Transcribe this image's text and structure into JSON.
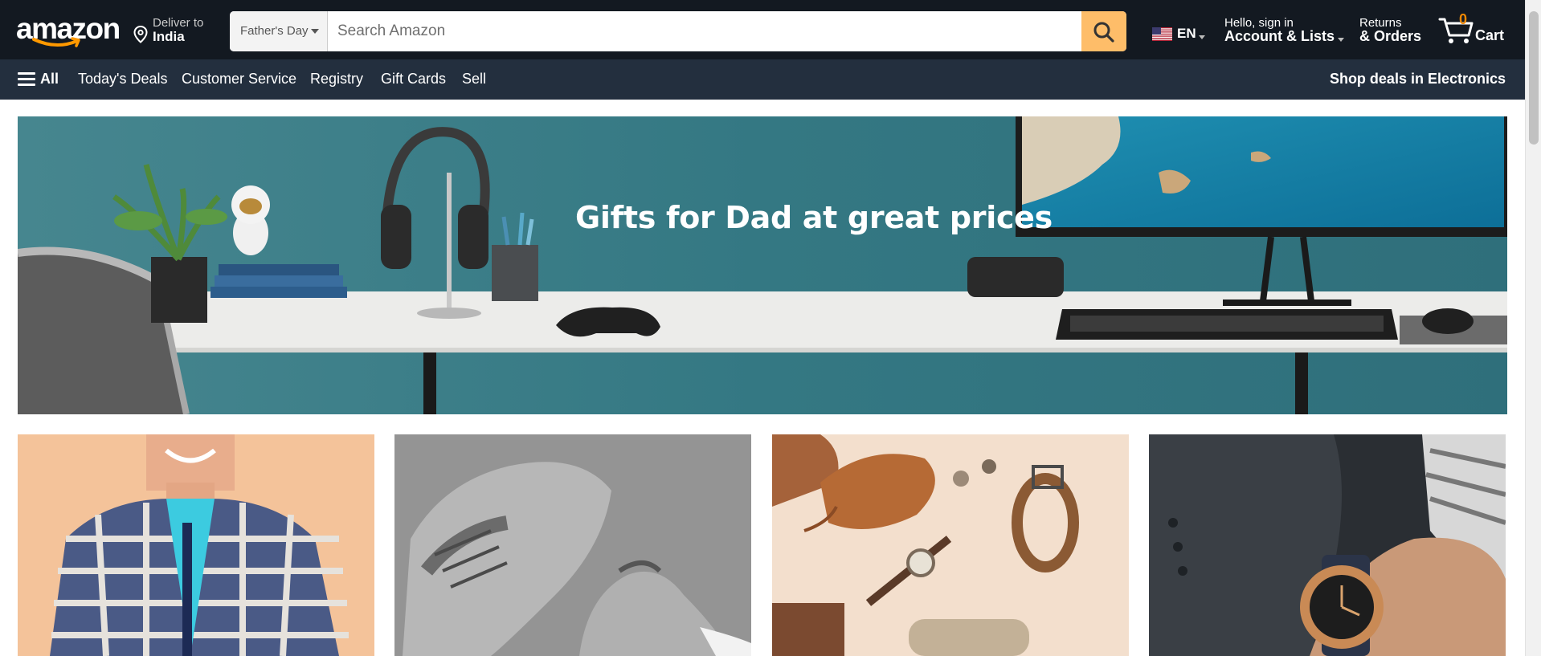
{
  "header": {
    "logo_alt": "amazon",
    "deliver": {
      "line1": "Deliver to",
      "line2": "India",
      "icon": "location-pin-icon"
    },
    "search": {
      "category": "Father's Day",
      "placeholder": "Search Amazon",
      "value": "",
      "button_icon": "search-icon"
    },
    "language": {
      "code": "EN",
      "flag_icon": "us-flag-icon"
    },
    "account": {
      "line1": "Hello, sign in",
      "line2": "Account & Lists"
    },
    "returns": {
      "line1": "Returns",
      "line2": "& Orders"
    },
    "cart": {
      "count": "0",
      "label": "Cart",
      "icon": "cart-icon"
    }
  },
  "subnav": {
    "all_label": "All",
    "items": [
      "Today's Deals",
      "Customer Service",
      "Registry",
      "Gift Cards",
      "Sell"
    ],
    "promo": "Shop deals in Electronics"
  },
  "hero": {
    "headline": "Gifts for Dad at great prices"
  },
  "tiles": [
    {
      "name": "shirt-tile"
    },
    {
      "name": "shoes-tile"
    },
    {
      "name": "accessories-tile"
    },
    {
      "name": "watch-tile"
    }
  ],
  "colors": {
    "nav_top": "#131921",
    "nav_sub": "#232f3e",
    "search_button": "#febd69",
    "cart_count": "#f08804",
    "hero_wall": "#3a7d88"
  }
}
